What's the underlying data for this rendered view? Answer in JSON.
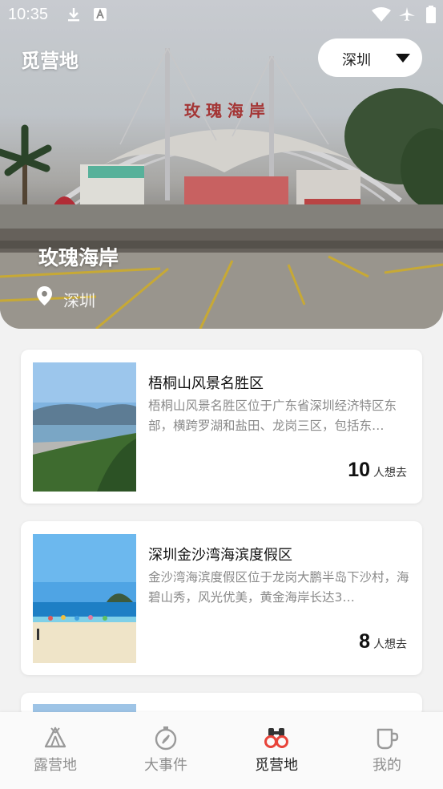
{
  "status_bar": {
    "time": "10:35"
  },
  "header": {
    "app_title": "觅营地",
    "city_select": "深圳"
  },
  "hero": {
    "title": "玫瑰海岸",
    "location": "深圳"
  },
  "cards": [
    {
      "title": "梧桐山风景名胜区",
      "description": "梧桐山风景名胜区位于广东省深圳经济特区东部，横跨罗湖和盐田、龙岗三区，包括东…",
      "count": "10",
      "count_label": "人想去"
    },
    {
      "title": "深圳金沙湾海滨度假区",
      "description": "金沙湾海滨度假区位于龙岗大鹏半岛下沙村，海碧山秀，风光优美，黄金海岸长达3…",
      "count": "8",
      "count_label": "人想去"
    }
  ],
  "tabs": [
    {
      "label": "露营地",
      "icon": "tent-icon"
    },
    {
      "label": "大事件",
      "icon": "compass-icon"
    },
    {
      "label": "觅营地",
      "icon": "binoculars-icon",
      "active": true
    },
    {
      "label": "我的",
      "icon": "cup-icon"
    }
  ],
  "colors": {
    "accent": "#e8443a",
    "icon_gray": "#9a9a9a"
  }
}
